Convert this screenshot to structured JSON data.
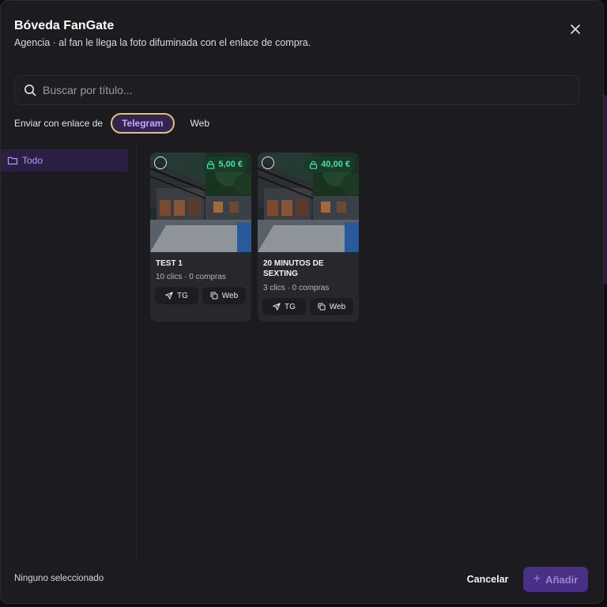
{
  "dialog": {
    "title": "Bóveda FanGate",
    "subtitle": "Agencia · al fan le llega la foto difuminada con el enlace de compra.",
    "close_icon": "close-icon"
  },
  "search": {
    "placeholder": "Buscar por título...",
    "value": "",
    "icon": "search-icon"
  },
  "send_with": {
    "label": "Enviar con enlace de",
    "options": [
      {
        "label": "Telegram",
        "selected": true
      },
      {
        "label": "Web",
        "selected": false
      }
    ]
  },
  "sidebar": {
    "items": [
      {
        "label": "Todo",
        "icon": "folder-icon",
        "selected": true
      }
    ]
  },
  "items": [
    {
      "title": "TEST 1",
      "price": "5,00 €",
      "stats": "10 clics · 0 compras",
      "tg_label": "TG",
      "web_label": "Web"
    },
    {
      "title": "20 MINUTOS DE SEXTING",
      "price": "40,00 €",
      "stats": "3 clics · 0 compras",
      "tg_label": "TG",
      "web_label": "Web"
    }
  ],
  "footer": {
    "status": "Ninguno seleccionado",
    "cancel_label": "Cancelar",
    "add_label": "Añadir"
  },
  "colors": {
    "accent": "#7c4dff",
    "price_green": "#4ce0a0",
    "selected_outline": "#e0c079"
  }
}
